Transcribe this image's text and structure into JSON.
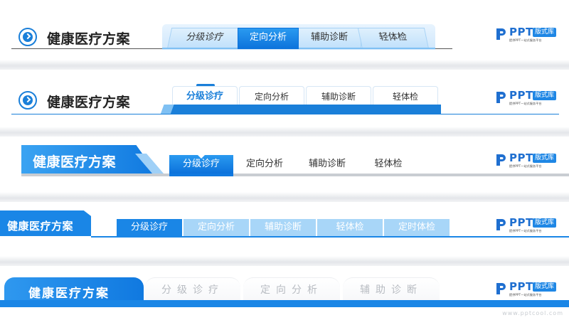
{
  "colors": {
    "accent": "#1a7fd9",
    "accent_light": "#a8d6f8",
    "tab_inactive_text": "#b8bcc2"
  },
  "logo": {
    "brand": "PPT",
    "badge": "版式库",
    "tagline": "提供PPT一站式服务平台",
    "mark_icon": "p-logo-icon"
  },
  "bands": [
    {
      "title": "健康医疗方案",
      "icon": "chevron-circle-icon",
      "tabs": [
        {
          "label": "分级诊疗"
        },
        {
          "label": "定向分析",
          "active": true
        },
        {
          "label": "辅助诊断"
        },
        {
          "label": "轻体检"
        }
      ]
    },
    {
      "title": "健康医疗方案",
      "icon": "chevron-circle-icon",
      "tabs": [
        {
          "label": "分级诊疗",
          "active": true
        },
        {
          "label": "定向分析"
        },
        {
          "label": "辅助诊断"
        },
        {
          "label": "轻体检"
        }
      ]
    },
    {
      "title": "健康医疗方案",
      "tabs": [
        {
          "label": "分级诊疗",
          "active": true
        },
        {
          "label": "定向分析"
        },
        {
          "label": "辅助诊断"
        },
        {
          "label": "轻体检"
        }
      ]
    },
    {
      "title": "健康医疗方案",
      "tabs": [
        {
          "label": "分级诊疗",
          "active": true
        },
        {
          "label": "定向分析"
        },
        {
          "label": "辅助诊断"
        },
        {
          "label": "轻体检"
        },
        {
          "label": "定时体检"
        }
      ]
    },
    {
      "title": "健康医疗方案",
      "tabs": [
        {
          "label": "分级诊疗"
        },
        {
          "label": "定向分析"
        },
        {
          "label": "辅助诊断"
        }
      ]
    }
  ],
  "watermark": "www.pptcool.com"
}
